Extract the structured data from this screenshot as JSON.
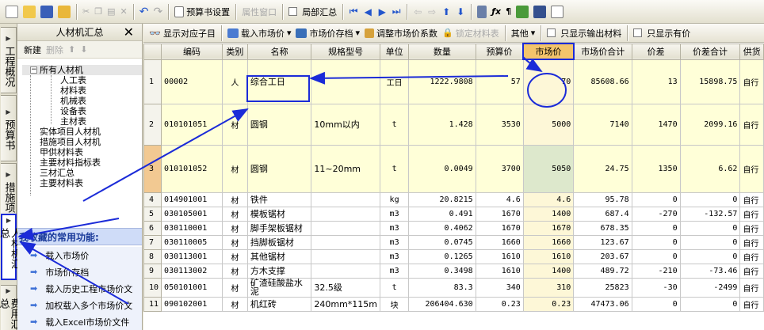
{
  "toolbar": {
    "budget_settings": "预算书设置",
    "property_window": "属性窗口",
    "local_summary": "局部汇总"
  },
  "vtabs": [
    {
      "label": "工程概况"
    },
    {
      "label": "预算书"
    },
    {
      "label": "措施项目"
    },
    {
      "label": "人材机汇总"
    },
    {
      "label": "费用汇总"
    }
  ],
  "left_panel": {
    "title": "人材机汇总",
    "new_label": "新建",
    "delete_label": "删除",
    "tree": {
      "root": "所有人材机",
      "children": [
        "人工表",
        "材料表",
        "机械表",
        "设备表",
        "主材表"
      ],
      "others": [
        "实体项目人材机",
        "措施项目人材机",
        "甲供材料表",
        "主要材料指标表",
        "三材汇总",
        "主要材料表"
      ]
    },
    "favorites_title": "我收藏的常用功能:",
    "favorites": [
      "载入市场价",
      "市场价存档",
      "载入历史工程市场价文",
      "加权载入多个市场价文",
      "载入Excel市场价文件"
    ]
  },
  "toolbar2": {
    "show_sub": "显示对应子目",
    "load_market": "载入市场价",
    "market_archive": "市场价存档",
    "adjust_coef": "调整市场价系数",
    "lock_material": "锁定材料表",
    "other": "其他",
    "only_output": "只显示输出材料",
    "only_some": "只显示有价"
  },
  "grid": {
    "headers": [
      "",
      "编码",
      "类别",
      "名称",
      "规格型号",
      "单位",
      "数量",
      "预算价",
      "市场价",
      "市场价合计",
      "价差",
      "价差合计",
      "供货"
    ],
    "rows": [
      {
        "n": "1",
        "code": "00002",
        "cat": "人",
        "name": "综合工日",
        "spec": "",
        "unit": "工日",
        "qty": "1222.9808",
        "budget": "57",
        "market": "70",
        "total": "85608.66",
        "diff": "13",
        "diff_total": "15898.75",
        "supply": "自行"
      },
      {
        "n": "2",
        "code": "010101051",
        "cat": "材",
        "name": "圆钢",
        "spec": "10mm以内",
        "unit": "t",
        "qty": "1.428",
        "budget": "3530",
        "market": "5000",
        "total": "7140",
        "diff": "1470",
        "diff_total": "2099.16",
        "supply": "自行"
      },
      {
        "n": "3",
        "code": "010101052",
        "cat": "材",
        "name": "圆钢",
        "spec": "11~20mm",
        "unit": "t",
        "qty": "0.0049",
        "budget": "3700",
        "market": "5050",
        "total": "24.75",
        "diff": "1350",
        "diff_total": "6.62",
        "supply": "自行"
      },
      {
        "n": "4",
        "code": "014901001",
        "cat": "材",
        "name": "铁件",
        "spec": "",
        "unit": "kg",
        "qty": "20.8215",
        "budget": "4.6",
        "market": "4.6",
        "total": "95.78",
        "diff": "0",
        "diff_total": "0",
        "supply": "自行"
      },
      {
        "n": "5",
        "code": "030105001",
        "cat": "材",
        "name": "模板锯材",
        "spec": "",
        "unit": "m3",
        "qty": "0.491",
        "budget": "1670",
        "market": "1400",
        "total": "687.4",
        "diff": "-270",
        "diff_total": "-132.57",
        "supply": "自行"
      },
      {
        "n": "6",
        "code": "030110001",
        "cat": "材",
        "name": "脚手架板锯材",
        "spec": "",
        "unit": "m3",
        "qty": "0.4062",
        "budget": "1670",
        "market": "1670",
        "total": "678.35",
        "diff": "0",
        "diff_total": "0",
        "supply": "自行"
      },
      {
        "n": "7",
        "code": "030110005",
        "cat": "材",
        "name": "挡脚板锯材",
        "spec": "",
        "unit": "m3",
        "qty": "0.0745",
        "budget": "1660",
        "market": "1660",
        "total": "123.67",
        "diff": "0",
        "diff_total": "0",
        "supply": "自行"
      },
      {
        "n": "8",
        "code": "030113001",
        "cat": "材",
        "name": "其他锯材",
        "spec": "",
        "unit": "m3",
        "qty": "0.1265",
        "budget": "1610",
        "market": "1610",
        "total": "203.67",
        "diff": "0",
        "diff_total": "0",
        "supply": "自行"
      },
      {
        "n": "9",
        "code": "030113002",
        "cat": "材",
        "name": "方木支撑",
        "spec": "",
        "unit": "m3",
        "qty": "0.3498",
        "budget": "1610",
        "market": "1400",
        "total": "489.72",
        "diff": "-210",
        "diff_total": "-73.46",
        "supply": "自行"
      },
      {
        "n": "10",
        "code": "050101001",
        "cat": "材",
        "name": "矿渣硅酸盐水泥",
        "spec": "32.5级",
        "unit": "t",
        "qty": "83.3",
        "budget": "340",
        "market": "310",
        "total": "25823",
        "diff": "-30",
        "diff_total": "-2499",
        "supply": "自行"
      },
      {
        "n": "11",
        "code": "090102001",
        "cat": "材",
        "name": "机红砖",
        "spec": "240mm*115m",
        "unit": "块",
        "qty": "206404.630",
        "budget": "0.23",
        "market": "0.23",
        "total": "47473.06",
        "diff": "0",
        "diff_total": "0",
        "supply": "自行"
      }
    ]
  },
  "colors": {
    "accent_blue": "#1b2bd8",
    "highlight_header": "#f3c46b",
    "row_yellow": "#ffffd8"
  }
}
